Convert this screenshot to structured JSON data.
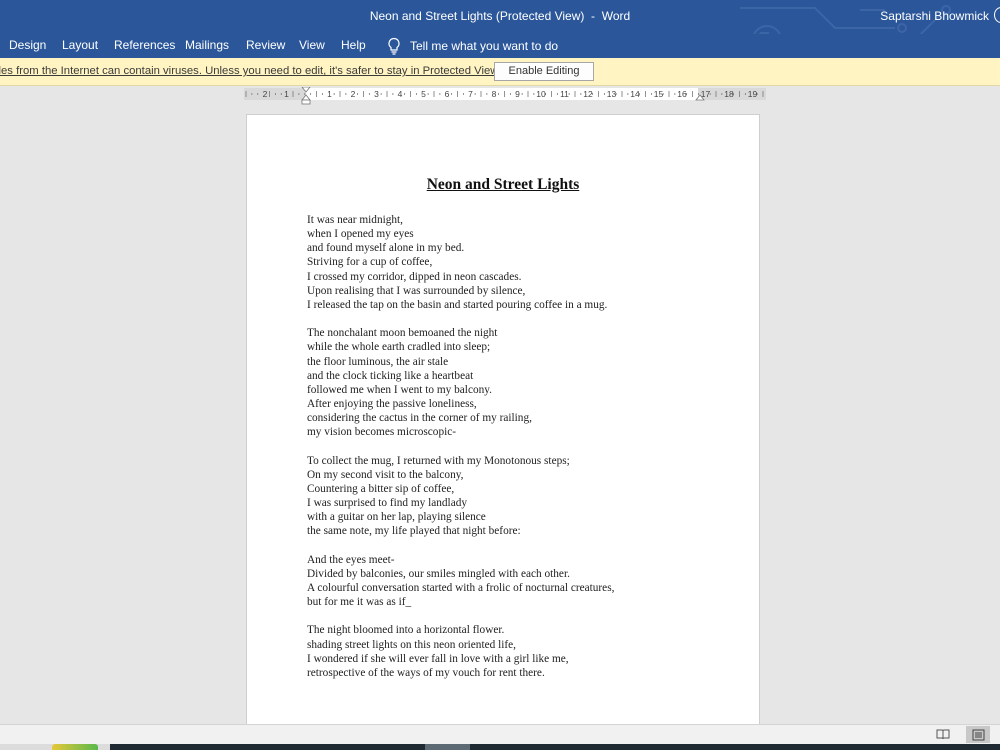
{
  "window": {
    "title": "Neon and Street Lights (Protected View)  -  Word",
    "user_name": "Saptarshi Bhowmick"
  },
  "ribbon": {
    "tabs": [
      {
        "label": "Design"
      },
      {
        "label": "Layout"
      },
      {
        "label": "References"
      },
      {
        "label": "Mailings"
      },
      {
        "label": "Review"
      },
      {
        "label": "View"
      },
      {
        "label": "Help"
      }
    ],
    "tell_me": "Tell me what you want to do"
  },
  "protected_view": {
    "message": "iles from the Internet can contain viruses. Unless you need to edit, it's safer to stay in Protected View.",
    "button": "Enable Editing"
  },
  "ruler": {
    "labels": [
      "2",
      "1",
      "1",
      "2",
      "3",
      "4",
      "5",
      "6",
      "7",
      "8",
      "9",
      "10",
      "11",
      "12",
      "13",
      "14",
      "15",
      "16",
      "17",
      "18",
      "19"
    ]
  },
  "document": {
    "title": "Neon and Street Lights",
    "stanzas": [
      [
        "It was near midnight,",
        "when I opened my eyes",
        "and found myself alone in my bed.",
        "Striving for a cup of coffee,",
        "I crossed my corridor, dipped in neon cascades.",
        "Upon realising that I was surrounded by silence,",
        "I released the tap on the basin and started pouring coffee in a mug."
      ],
      [
        "The nonchalant moon bemoaned the night",
        "while the whole earth cradled into sleep;",
        "the floor luminous, the air stale",
        "and the clock ticking like a heartbeat",
        "followed me when I went to my balcony.",
        "After enjoying the passive loneliness,",
        "considering the cactus in the corner of my railing,",
        "my vision becomes microscopic-"
      ],
      [
        "To collect the mug, I returned with my Monotonous steps;",
        "On my second visit to the balcony,",
        "Countering a bitter sip of coffee,",
        "I was surprised to find my landlady",
        "with a guitar on her lap, playing silence",
        "the same note, my life played that night before:"
      ],
      [
        "And the eyes meet-",
        "Divided by balconies, our smiles mingled with each other.",
        "A colourful conversation started with a frolic of nocturnal creatures,",
        "but for me it was as if_"
      ],
      [
        "The night bloomed into a horizontal flower.",
        "shading street lights on this neon oriented life,",
        "I wondered if she will ever fall in love with a girl like me,",
        "retrospective of the ways of my vouch for rent there."
      ]
    ]
  },
  "colors": {
    "titlebar": "#2b579a",
    "protected_bar": "#fff4c2",
    "page": "#ffffff",
    "workspace": "#e6e6e6"
  },
  "icons": {
    "tell_me": "lightbulb-icon",
    "read_mode": "read-mode-icon",
    "print_layout": "print-layout-icon"
  }
}
